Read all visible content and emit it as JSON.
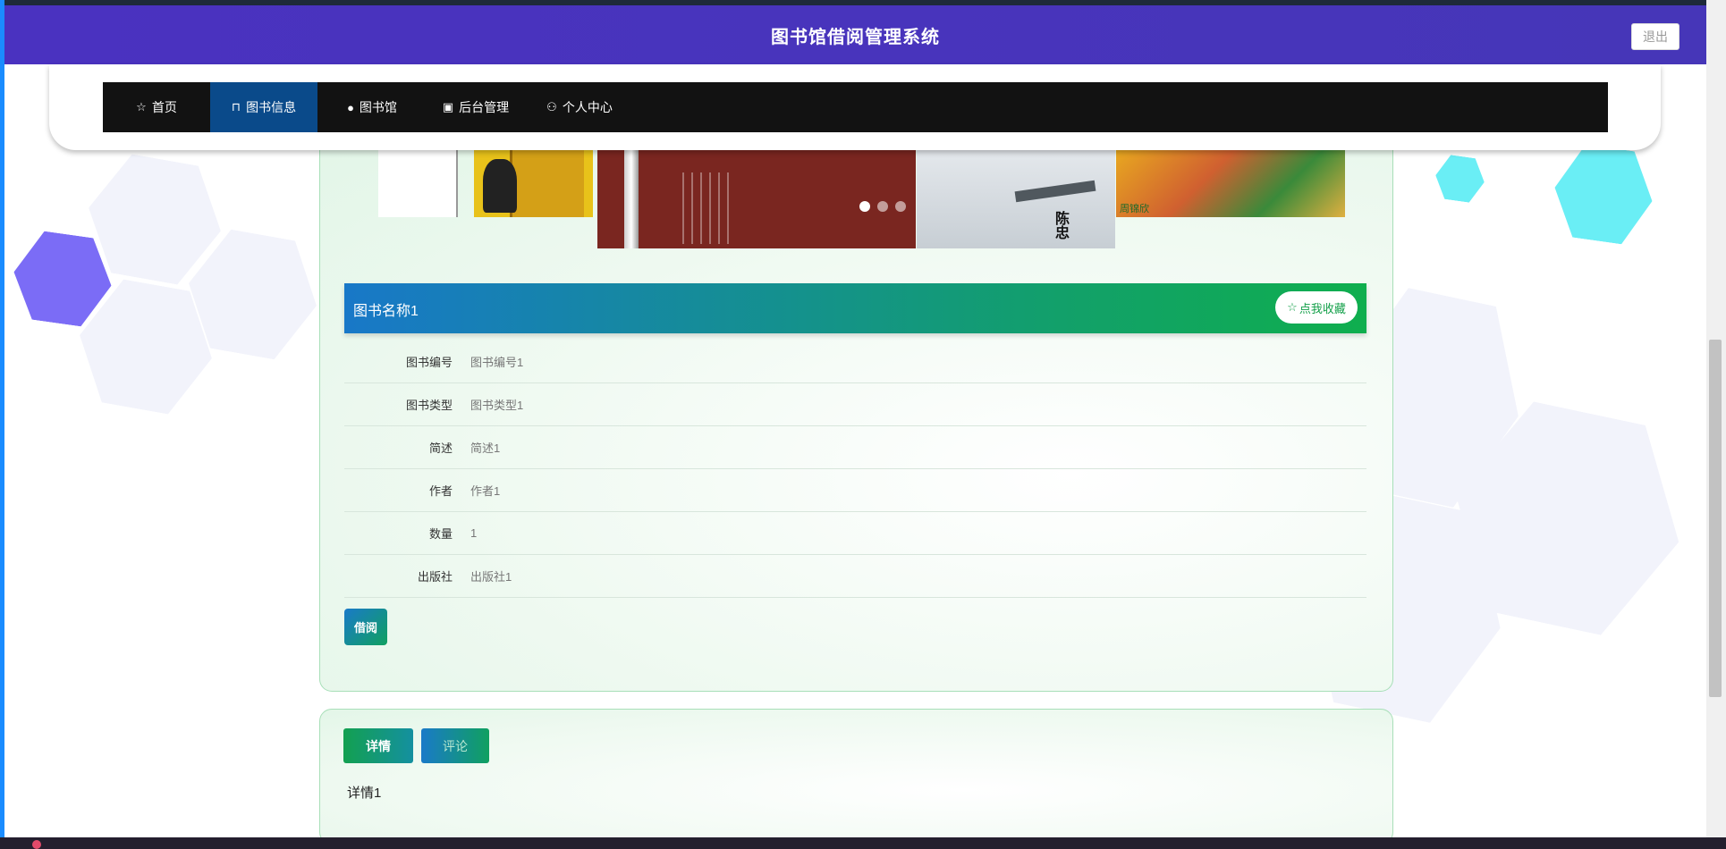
{
  "header": {
    "title": "图书馆借阅管理系统",
    "logout_label": "退出"
  },
  "nav": {
    "items": [
      {
        "label": "首页",
        "icon": "star-icon"
      },
      {
        "label": "图书信息",
        "icon": "bag-icon",
        "active": true
      },
      {
        "label": "图书馆",
        "icon": "info-icon"
      },
      {
        "label": "后台管理",
        "icon": "box-icon"
      },
      {
        "label": "个人中心",
        "icon": "user-icon"
      }
    ]
  },
  "carousel": {
    "slide3_chars": "陈忠",
    "slide5_tag": "周锦欣",
    "active_index": 0,
    "dot_count": 3
  },
  "book": {
    "name": "图书名称1",
    "favorite_label": "点我收藏",
    "fields": [
      {
        "label": "图书编号",
        "value": "图书编号1"
      },
      {
        "label": "图书类型",
        "value": "图书类型1"
      },
      {
        "label": "简述",
        "value": "简述1"
      },
      {
        "label": "作者",
        "value": "作者1"
      },
      {
        "label": "数量",
        "value": "1"
      },
      {
        "label": "出版社",
        "value": "出版社1"
      }
    ],
    "borrow_label": "借阅"
  },
  "tabs": {
    "detail_label": "详情",
    "comment_label": "评论",
    "active": "detail"
  },
  "detail": {
    "content": "详情1"
  },
  "colors": {
    "header": "#4a32c0",
    "nav_bg": "#121212",
    "nav_active": "#0a4a8a",
    "accent_green": "#10a060",
    "accent_blue": "#1878c8"
  }
}
